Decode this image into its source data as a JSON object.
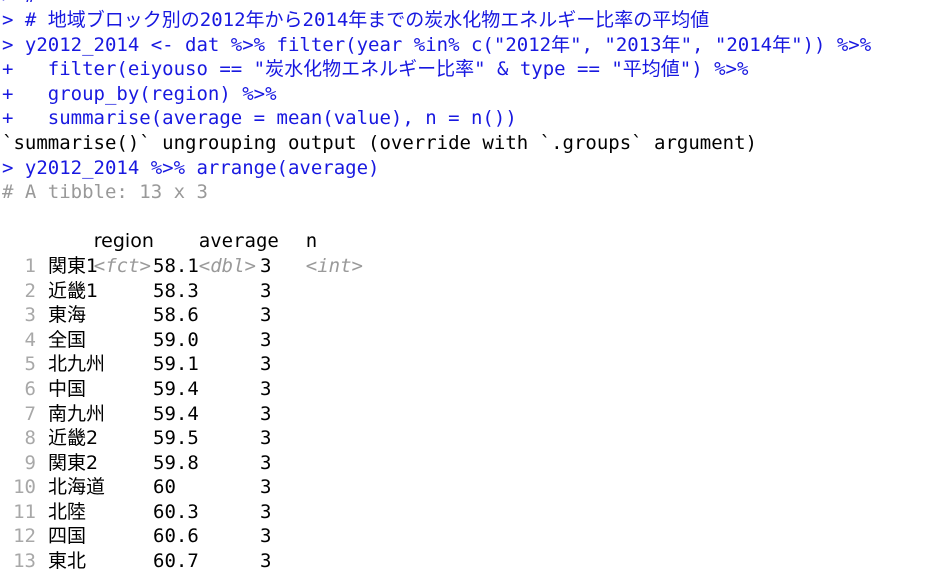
{
  "console": {
    "app": "R Console",
    "prompt_symbol": ">",
    "continuation_symbol": "+",
    "colors": {
      "input": "#1818e0",
      "output": "#000000",
      "meta": "#999999",
      "type": "#9a9a9a",
      "background": "#ffffff"
    },
    "lines": [
      {
        "kind": "input",
        "text": "> #"
      },
      {
        "kind": "input",
        "text": "> # 地域ブロック別の2012年から2014年までの炭水化物エネルギー比率の平均値"
      },
      {
        "kind": "input",
        "text": "> y2012_2014 <- dat %>% filter(year %in% c(\"2012年\", \"2013年\", \"2014年\")) %>%"
      },
      {
        "kind": "input",
        "text": "+   filter(eiyouso == \"炭水化物エネルギー比率\" & type == \"平均値\") %>%"
      },
      {
        "kind": "input",
        "text": "+   group_by(region) %>%"
      },
      {
        "kind": "input",
        "text": "+   summarise(average = mean(value), n = n())"
      },
      {
        "kind": "output",
        "text": "`summarise()` ungrouping output (override with `.groups` argument)"
      },
      {
        "kind": "input",
        "text": "> y2012_2014 %>% arrange(average)"
      },
      {
        "kind": "meta",
        "text": "# A tibble: 13 x 3"
      }
    ]
  },
  "tibble": {
    "summary": "# A tibble: 13 x 3",
    "n_rows": 13,
    "n_cols": 3,
    "headers": [
      "region",
      "average",
      "n"
    ],
    "types": [
      "<fct>",
      "<dbl>",
      "<int>"
    ],
    "rows": [
      {
        "idx": "1",
        "region": "関東1",
        "average": "58.1",
        "n": "3"
      },
      {
        "idx": "2",
        "region": "近畿1",
        "average": "58.3",
        "n": "3"
      },
      {
        "idx": "3",
        "region": "東海",
        "average": "58.6",
        "n": "3"
      },
      {
        "idx": "4",
        "region": "全国",
        "average": "59.0",
        "n": "3"
      },
      {
        "idx": "5",
        "region": "北九州",
        "average": "59.1",
        "n": "3"
      },
      {
        "idx": "6",
        "region": "中国",
        "average": "59.4",
        "n": "3"
      },
      {
        "idx": "7",
        "region": "南九州",
        "average": "59.4",
        "n": "3"
      },
      {
        "idx": "8",
        "region": "近畿2",
        "average": "59.5",
        "n": "3"
      },
      {
        "idx": "9",
        "region": "関東2",
        "average": "59.8",
        "n": "3"
      },
      {
        "idx": "10",
        "region": "北海道",
        "average": "60",
        "n": "3"
      },
      {
        "idx": "11",
        "region": "北陸",
        "average": "60.3",
        "n": "3"
      },
      {
        "idx": "12",
        "region": "四国",
        "average": "60.6",
        "n": "3"
      },
      {
        "idx": "13",
        "region": "東北",
        "average": "60.7",
        "n": "3"
      }
    ]
  }
}
